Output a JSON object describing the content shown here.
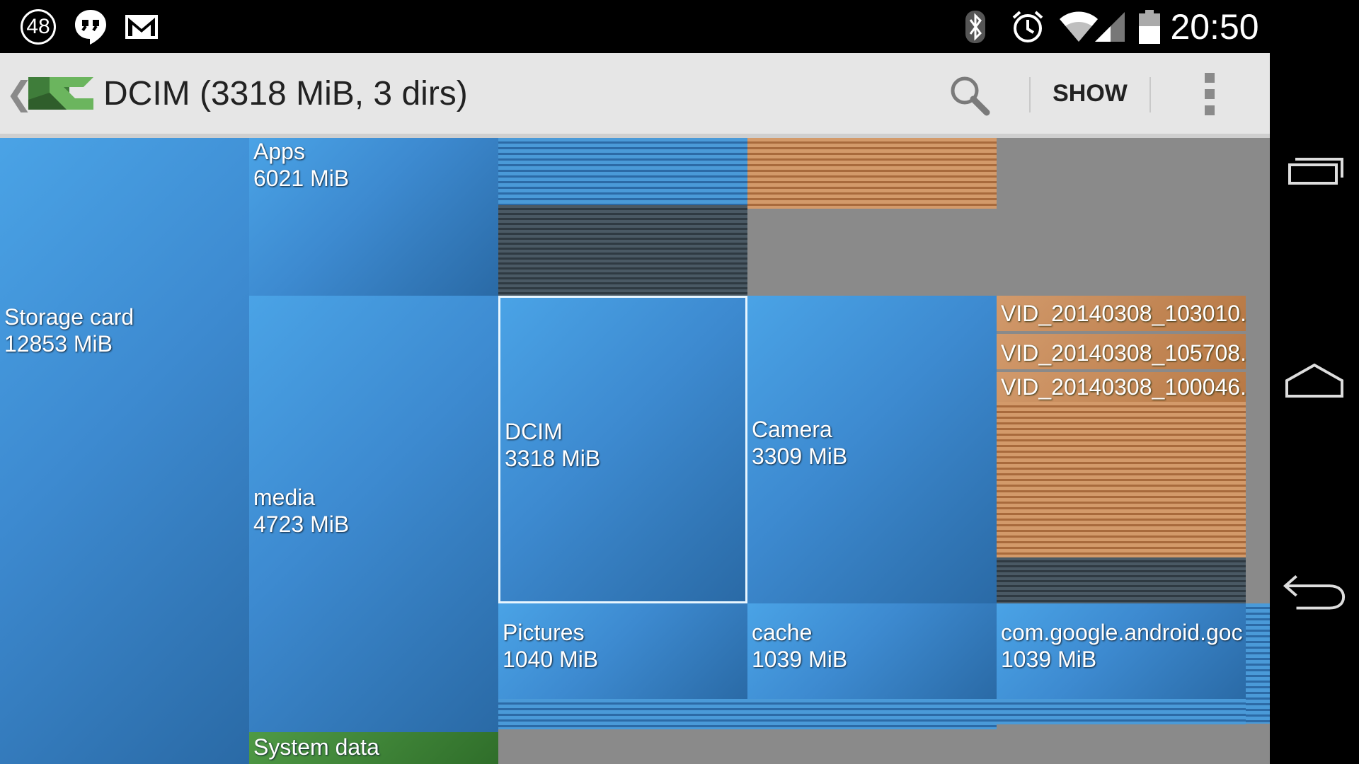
{
  "status_bar": {
    "notification_count": "48",
    "icons": [
      "notification-count-icon",
      "hangouts-icon",
      "gmail-icon",
      "bluetooth-icon",
      "alarm-icon",
      "wifi-icon",
      "cell-signal-icon",
      "battery-icon"
    ],
    "clock": "20:50"
  },
  "action_bar": {
    "title": "DCIM (3318 MiB, 3 dirs)",
    "show_label": "SHOW",
    "icons": [
      "up-chevron-icon",
      "app-logo-icon",
      "search-icon",
      "overflow-menu-icon"
    ]
  },
  "treemap": {
    "tiles": [
      {
        "name": "Storage card",
        "size": "12853 MiB"
      },
      {
        "name": "Apps",
        "size": "6021 MiB"
      },
      {
        "name": "media",
        "size": "4723 MiB"
      },
      {
        "name": "DCIM",
        "size": "3318 MiB"
      },
      {
        "name": "Camera",
        "size": "3309 MiB"
      },
      {
        "name": "Pictures",
        "size": "1040 MiB"
      },
      {
        "name": "cache",
        "size": "1039 MiB"
      },
      {
        "name": "com.google.android.goc",
        "size": "1039 MiB"
      },
      {
        "name": "System data",
        "size": ""
      }
    ],
    "files": [
      "VID_20140308_103010.",
      "VID_20140308_105708.",
      "VID_20140308_100046."
    ]
  },
  "nav_bar": {
    "icons": [
      "recent-apps-icon",
      "home-icon",
      "back-icon"
    ]
  },
  "colors": {
    "folder_blue": "#3d8ad0",
    "file_brown": "#b77844",
    "system_green": "#4f9a45",
    "free_gray": "#8a8a8a"
  }
}
